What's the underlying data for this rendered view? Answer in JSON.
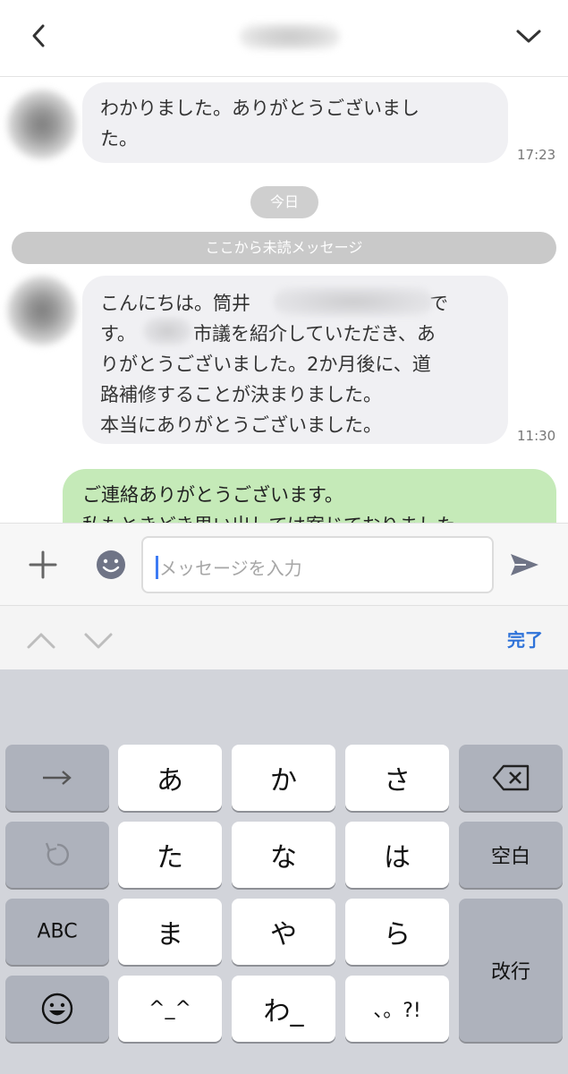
{
  "header": {
    "back_icon": "chevron-left-icon",
    "menu_icon": "chevron-down-icon"
  },
  "messages": [
    {
      "direction": "incoming",
      "lines": [
        "わかりました。ありがとうございまし",
        "た。"
      ],
      "time": "17:23"
    },
    {
      "direction": "incoming",
      "lines": [
        "こんにちは。筒井",
        "で",
        "す。",
        "市議を紹介していただき、あ",
        "りがとうございました。2か月後に、道",
        "路補修することが決まりました。",
        "本当にありがとうございました。"
      ],
      "time": "11:30"
    },
    {
      "direction": "outgoing",
      "lines": [
        "ご連絡ありがとうございます。",
        "私もときどき思い出しては案じておりました"
      ]
    }
  ],
  "separators": {
    "today": "今日",
    "unread": "ここから未読メッセージ"
  },
  "input": {
    "placeholder": "メッセージを入力",
    "value": ""
  },
  "accessory": {
    "done_label": "完了"
  },
  "keyboard": {
    "rows": [
      [
        "→",
        "あ",
        "か",
        "さ",
        "⌫"
      ],
      [
        "↺",
        "た",
        "な",
        "は",
        "空白"
      ],
      [
        "ABC",
        "ま",
        "や",
        "ら",
        "改行"
      ],
      [
        "☺",
        "^^",
        "わ_",
        "、。?!"
      ]
    ],
    "labels": {
      "arrow": "→",
      "a": "あ",
      "ka": "か",
      "sa": "さ",
      "ta": "た",
      "na": "な",
      "ha": "は",
      "space": "空白",
      "abc": "ABC",
      "ma": "ま",
      "ya": "や",
      "ra": "ら",
      "enter": "改行",
      "kaomoji": "^_^",
      "wa": "わ_",
      "punct": "、。?!"
    }
  }
}
